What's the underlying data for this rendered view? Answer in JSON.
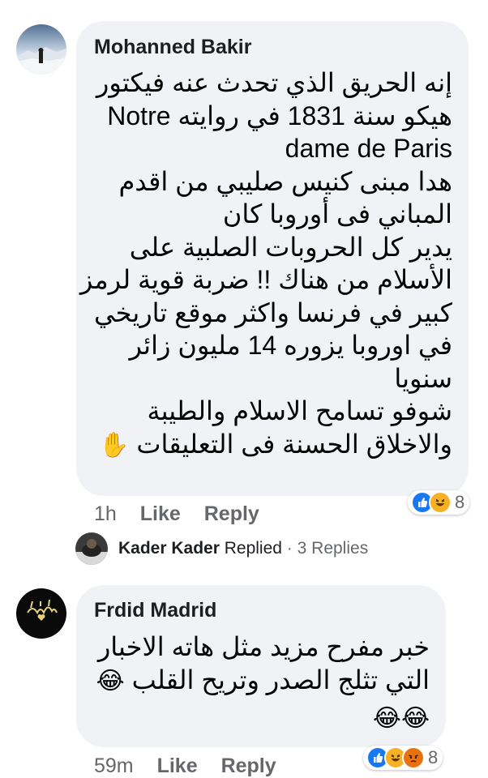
{
  "comments": [
    {
      "author": "Mohanned Bakir",
      "lines": [
        "إنه الحريق الذي تحدث عنه فيكتور",
        "هيكو سنة 1831 في روايته Notre",
        "dame de Paris",
        "هدا مبنى كنيس صليبي من اقدم",
        "المباني فى أوروبا  كان",
        "يدير كل الحروبات الصلبية على",
        "الأسلام من هناك !! ضربة قوية لرمز",
        "كبير في فرنسا واكثر موقع تاريخي",
        "في اوروبا يزوره 14 مليون زائر",
        "سنويا",
        "شوفو تسامح الاسلام والطيبة",
        "والاخلاق الحسنة فى التعليقات"
      ],
      "trailing_emoji": "✋",
      "time": "1h",
      "like_label": "Like",
      "reply_label": "Reply",
      "reaction_count": "8",
      "reactions": [
        "like-icon",
        "haha-icon"
      ]
    },
    {
      "author": "Frdid Madrid",
      "lines": [
        "خبر مفرح مزيد مثل هاته الاخبار",
        "التي تثلج الصدر وتريح القلب"
      ],
      "trailing_emoji": "😂",
      "emoji_line": "😂😂",
      "time": "59m",
      "like_label": "Like",
      "reply_label": "Reply",
      "reaction_count": "8",
      "reactions": [
        "like-icon",
        "haha-icon",
        "angry-icon"
      ]
    }
  ],
  "replies_summary": {
    "name": "Kader Kader",
    "action": "Replied",
    "separator": "·",
    "count_label": "3 Replies"
  },
  "colors": {
    "bubble": "#f0f2f5",
    "like_blue": "#1877f2",
    "haha_yellow": "#f7b125",
    "angry_red": "#e9710f",
    "meta_gray": "#65676b"
  }
}
